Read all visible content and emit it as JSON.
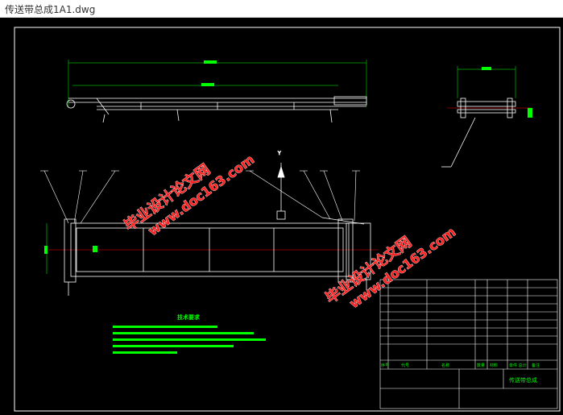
{
  "window": {
    "title": "传送带总成1A1.dwg"
  },
  "colors": {
    "background": "#000000",
    "frame": "#ffffff",
    "dimension": "#00ff00",
    "centerline": "#ff0000",
    "watermark": "#ff2020"
  },
  "watermarks": [
    {
      "line1": "毕业设计论文网",
      "line2": "www.doc163.com"
    },
    {
      "line1": "毕业设计论文网",
      "line2": "www.doc163.com"
    }
  ],
  "drawing": {
    "notes_title": "技术要求",
    "title_block": {
      "drawing_name": "传送带总成",
      "col_no": "序号",
      "col_code": "代号",
      "col_name": "名称",
      "col_qty": "数量",
      "col_material": "材料",
      "col_weight": "单件 总计",
      "col_remark": "备注"
    }
  }
}
